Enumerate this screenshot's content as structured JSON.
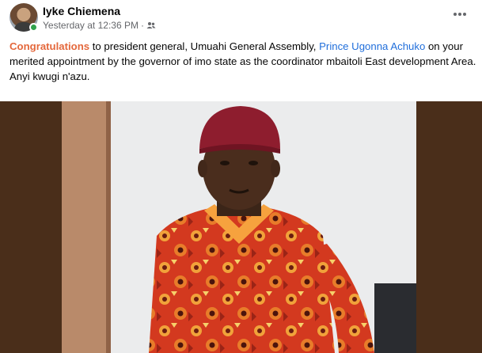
{
  "post": {
    "author": "Iyke Chiemena",
    "timestamp": "Yesterday at 12:36 PM",
    "meta_separator": "·",
    "audience_icon": "friends-icon",
    "more_icon": "more-options-icon",
    "text": {
      "highlight": "Congratulations",
      "part1": " to president general, Umuahi General Assembly, ",
      "mention": "Prince Ugonna Achuko",
      "part2": " on your merited appointment by the governor of imo state as the coordinator mbaitoli East development Area.",
      "line2": "Anyi kwugi n'azu."
    },
    "colors": {
      "highlight": "#e4683c",
      "mention": "#216fdb",
      "online": "#31a24c"
    }
  }
}
